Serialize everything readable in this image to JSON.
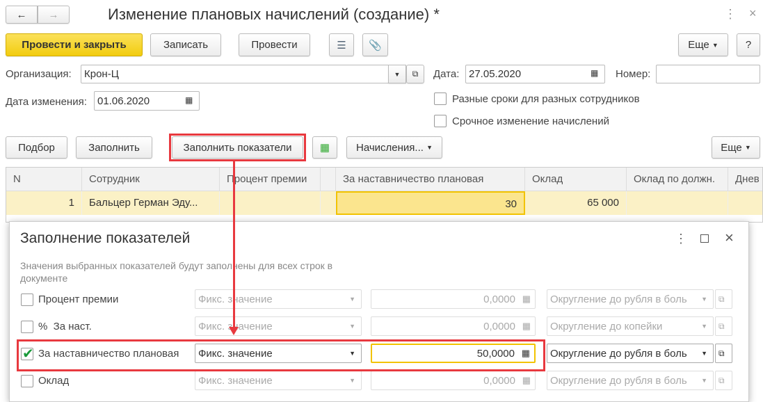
{
  "window": {
    "title": "Изменение плановых начислений (создание) *"
  },
  "toolbar": {
    "post_close": "Провести и закрыть",
    "save": "Записать",
    "post": "Провести",
    "more": "Еще",
    "help": "?"
  },
  "header": {
    "org_label": "Организация:",
    "org_value": "Крон-Ц",
    "date_label": "Дата:",
    "date_value": "27.05.2020",
    "number_label": "Номер:",
    "number_value": "",
    "change_date_label": "Дата изменения:",
    "change_date_value": "01.06.2020",
    "chk_diff_terms": "Разные сроки для разных сотрудников",
    "chk_urgent": "Срочное изменение начислений"
  },
  "table_toolbar": {
    "select": "Подбор",
    "fill": "Заполнить",
    "fill_indicators": "Заполнить показатели",
    "accruals": "Начисления...",
    "more": "Еще"
  },
  "table": {
    "columns": [
      "N",
      "Сотрудник",
      "Процент премии",
      "",
      "За наставничество плановая",
      "Оклад",
      "Оклад по должн.",
      "Днев"
    ],
    "rows": [
      [
        "1",
        "Бальцер Герман Эду...",
        "",
        "",
        "30",
        "65 000",
        "",
        ""
      ]
    ]
  },
  "dialog": {
    "title": "Заполнение показателей",
    "description": "Значения выбранных показателей будут заполнены для всех строк в документе",
    "rows": [
      {
        "checked": false,
        "label": "Процент премии",
        "mode": "Фикс. значение",
        "value": "0,0000",
        "rounding": "Округление до рубля в боль"
      },
      {
        "checked": false,
        "label": "%  За наст.",
        "mode": "Фикс. значение",
        "value": "0,0000",
        "rounding": "Округление до копейки"
      },
      {
        "checked": true,
        "label": "За наставничество плановая",
        "mode": "Фикс. значение",
        "value": "50,0000",
        "rounding": "Округление до рубля в боль"
      },
      {
        "checked": false,
        "label": "Оклад",
        "mode": "Фикс. значение",
        "value": "0,0000",
        "rounding": "Округление до рубля в боль"
      }
    ]
  },
  "colors": {
    "accent_yellow": "#f5d21c",
    "highlight": "#e8393f",
    "row_selected": "#fbf1c6"
  }
}
